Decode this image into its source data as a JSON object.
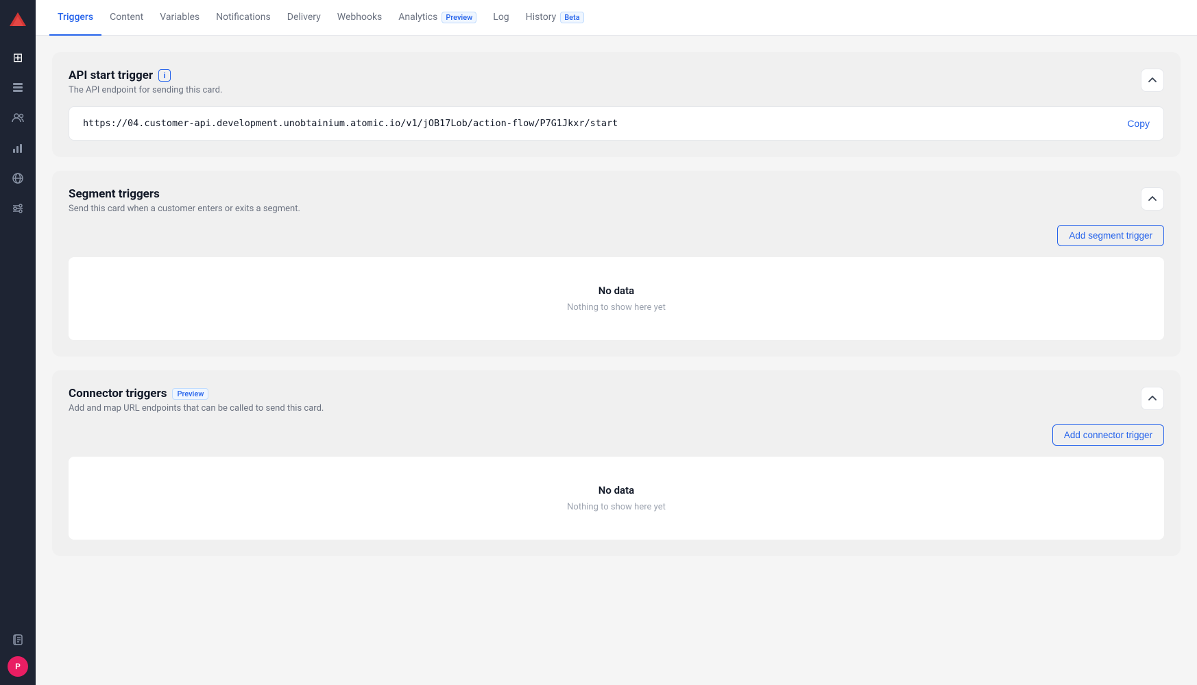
{
  "sidebar": {
    "icons": [
      {
        "name": "grid-icon",
        "symbol": "⊞",
        "active": false
      },
      {
        "name": "card-icon",
        "symbol": "▤",
        "active": true
      },
      {
        "name": "users-icon",
        "symbol": "👥",
        "active": false
      },
      {
        "name": "chart-icon",
        "symbol": "📊",
        "active": false
      },
      {
        "name": "globe-icon",
        "symbol": "○",
        "active": false
      },
      {
        "name": "settings-icon",
        "symbol": "⚙",
        "active": false
      }
    ],
    "bottom_icons": [
      {
        "name": "pages-icon",
        "symbol": "□"
      },
      {
        "name": "avatar",
        "initials": "P"
      }
    ]
  },
  "nav": {
    "tabs": [
      {
        "label": "Triggers",
        "active": true,
        "badge": null
      },
      {
        "label": "Content",
        "active": false,
        "badge": null
      },
      {
        "label": "Variables",
        "active": false,
        "badge": null
      },
      {
        "label": "Notifications",
        "active": false,
        "badge": null
      },
      {
        "label": "Delivery",
        "active": false,
        "badge": null
      },
      {
        "label": "Webhooks",
        "active": false,
        "badge": null
      },
      {
        "label": "Analytics",
        "active": false,
        "badge": "Preview"
      },
      {
        "label": "Log",
        "active": false,
        "badge": null
      },
      {
        "label": "History",
        "active": false,
        "badge": "Beta"
      }
    ]
  },
  "sections": {
    "api_trigger": {
      "title": "API start trigger",
      "has_info_icon": true,
      "subtitle": "The API endpoint for sending this card.",
      "url": "https://04.customer-api.development.unobtainium.atomic.io/v1/jOB17Lob/action-flow/P7G1Jkxr/start",
      "copy_label": "Copy"
    },
    "segment_triggers": {
      "title": "Segment triggers",
      "subtitle": "Send this card when a customer enters or exits a segment.",
      "add_button_label": "Add segment trigger",
      "empty_title": "No data",
      "empty_subtitle": "Nothing to show here yet"
    },
    "connector_triggers": {
      "title": "Connector triggers",
      "preview_badge": "Preview",
      "subtitle": "Add and map URL endpoints that can be called to send this card.",
      "add_button_label": "Add connector trigger",
      "empty_title": "No data",
      "empty_subtitle": "Nothing to show here yet"
    }
  }
}
